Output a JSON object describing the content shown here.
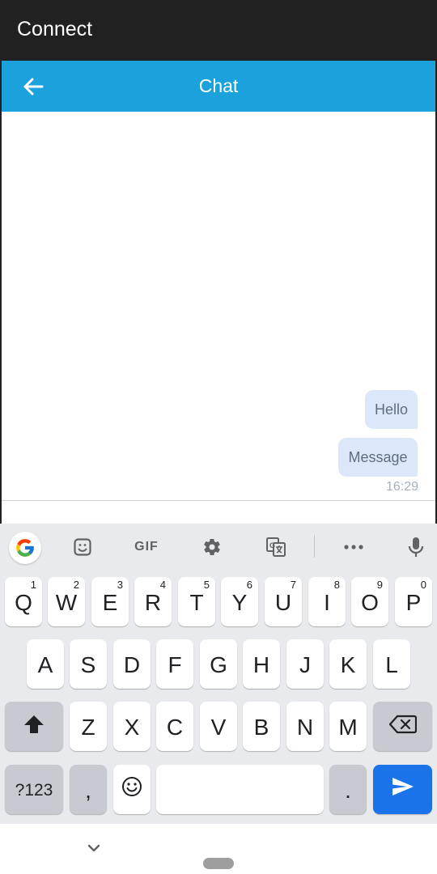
{
  "app": {
    "title": "Connect"
  },
  "chat": {
    "title": "Chat",
    "messages": [
      {
        "text": "Hello"
      },
      {
        "text": "Message"
      }
    ],
    "timestamp": "16:29"
  },
  "keyboard": {
    "toolbar": {
      "items": [
        "google-icon",
        "sticker-icon",
        "GIF",
        "settings-icon",
        "translate-icon",
        "more-icon",
        "mic-icon"
      ],
      "gif_label": "GIF"
    },
    "row1": [
      {
        "label": "Q",
        "hint": "1"
      },
      {
        "label": "W",
        "hint": "2"
      },
      {
        "label": "E",
        "hint": "3"
      },
      {
        "label": "R",
        "hint": "4"
      },
      {
        "label": "T",
        "hint": "5"
      },
      {
        "label": "Y",
        "hint": "6"
      },
      {
        "label": "U",
        "hint": "7"
      },
      {
        "label": "I",
        "hint": "8"
      },
      {
        "label": "O",
        "hint": "9"
      },
      {
        "label": "P",
        "hint": "0"
      }
    ],
    "row2": [
      {
        "label": "A"
      },
      {
        "label": "S"
      },
      {
        "label": "D"
      },
      {
        "label": "F"
      },
      {
        "label": "G"
      },
      {
        "label": "H"
      },
      {
        "label": "J"
      },
      {
        "label": "K"
      },
      {
        "label": "L"
      }
    ],
    "row3": [
      {
        "label": "Z"
      },
      {
        "label": "X"
      },
      {
        "label": "C"
      },
      {
        "label": "V"
      },
      {
        "label": "B"
      },
      {
        "label": "N"
      },
      {
        "label": "M"
      }
    ],
    "row4": {
      "symbols_label": "?123",
      "comma_label": ",",
      "period_label": "."
    }
  },
  "colors": {
    "status_bar": "#212121",
    "chat_header": "#1ba1dc",
    "bubble": "#dce8fa",
    "keyboard_bg": "#e8eaed",
    "send_key": "#1a73e8"
  }
}
